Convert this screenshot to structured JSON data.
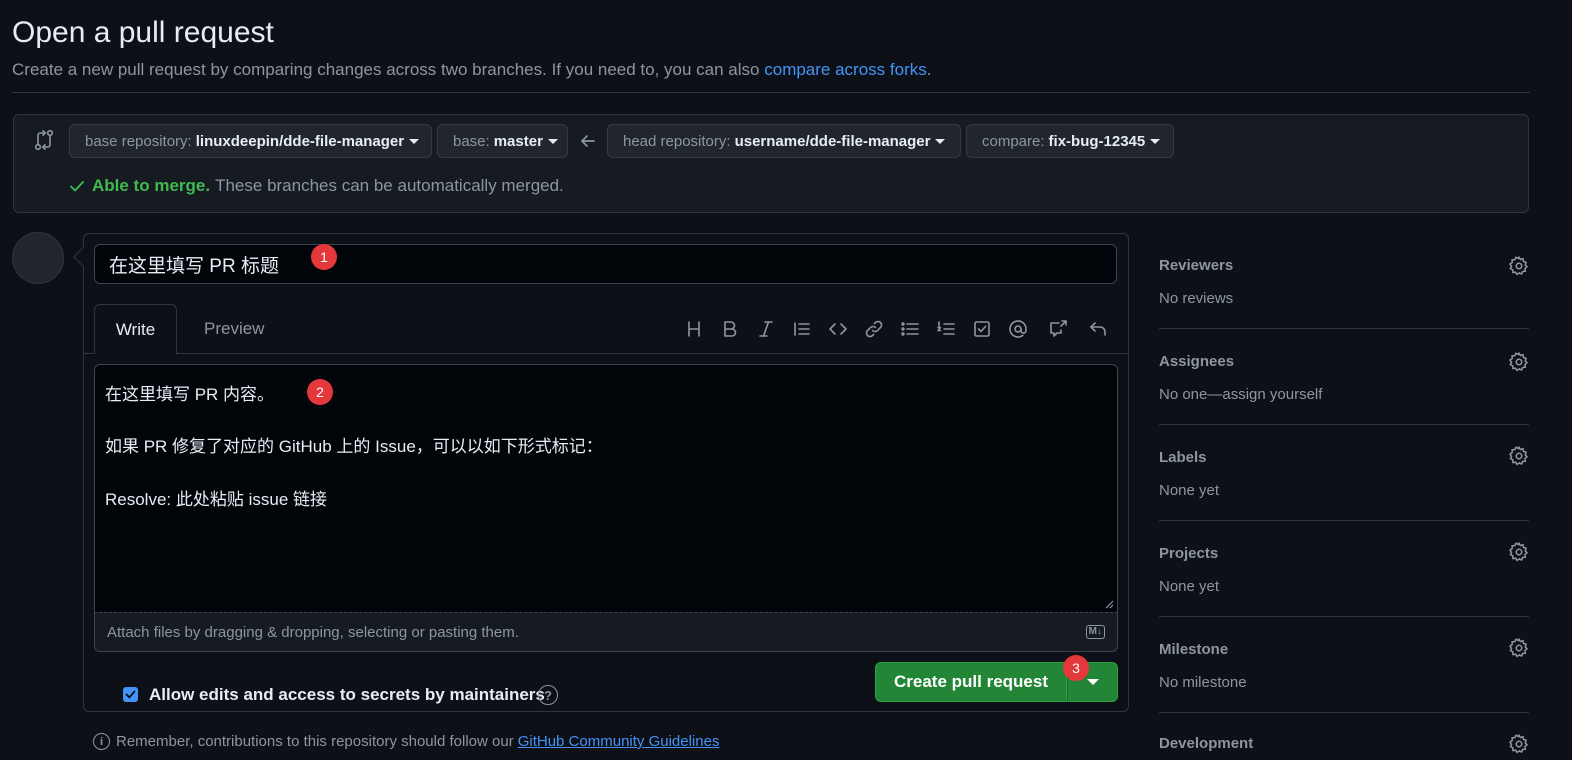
{
  "header": {
    "title": "Open a pull request",
    "subtitle": "Create a new pull request by comparing changes across two branches. If you need to, you can also",
    "subtitle_link": "compare across forks",
    "subtitle_end": "."
  },
  "compare": {
    "base_repo_label": "base repository:",
    "base_repo_value": "linuxdeepin/dde-file-manager",
    "base_label": "base:",
    "base_value": "master",
    "head_repo_label": "head repository:",
    "head_repo_value": "username/dde-file-manager",
    "compare_label": "compare:",
    "compare_value": "fix-bug-12345",
    "merge_status": "Able to merge.",
    "merge_message": "These branches can be automatically merged."
  },
  "form": {
    "title_value": "在这里填写 PR 标题",
    "tabs": [
      "Write",
      "Preview"
    ],
    "toolbar_icons": [
      "heading-icon",
      "bold-icon",
      "italic-icon",
      "quote-icon",
      "code-icon",
      "link-icon",
      "unordered-list-icon",
      "ordered-list-icon",
      "task-list-icon",
      "mention-icon",
      "reference-icon",
      "undo-icon"
    ],
    "body_lines": [
      "在这里填写 PR 内容。",
      "",
      "如果 PR 修复了对应的 GitHub 上的 Issue，可以以如下形式标记：",
      "",
      "Resolve: 此处粘贴 issue 链接"
    ],
    "attach_text": "Attach files by dragging & dropping, selecting or pasting them.",
    "markdown_badge": "M↓",
    "allow_edits_label": "Allow edits and access to secrets by maintainers",
    "allow_edits_checked": true,
    "help_glyph": "?",
    "create_button": "Create pull request",
    "footnote": "Remember, contributions to this repository should follow our",
    "footnote_link": "GitHub Community Guidelines",
    "info_glyph": "i"
  },
  "annotations": [
    "1",
    "2",
    "3"
  ],
  "sidebar": {
    "sections": [
      {
        "title": "Reviewers",
        "value": "No reviews"
      },
      {
        "title": "Assignees",
        "value": "No one—assign yourself"
      },
      {
        "title": "Labels",
        "value": "None yet"
      },
      {
        "title": "Projects",
        "value": "None yet"
      },
      {
        "title": "Milestone",
        "value": "No milestone"
      },
      {
        "title": "Development",
        "value": ""
      }
    ]
  },
  "colors": {
    "background": "#0d1117",
    "accent_link": "#4493f8",
    "success": "#3fb950",
    "primary_button": "#238636",
    "annotation_badge": "#e5383b"
  }
}
